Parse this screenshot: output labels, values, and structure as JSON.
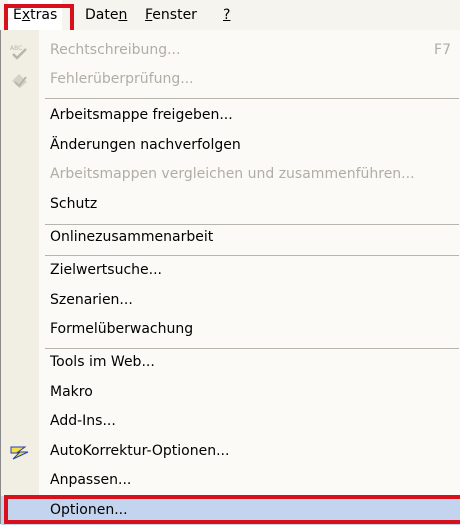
{
  "menubar": {
    "items": [
      {
        "label": "Extras",
        "active": true
      },
      {
        "label": "Daten"
      },
      {
        "label": "Fenster"
      },
      {
        "label": "?"
      }
    ]
  },
  "menu": {
    "items": {
      "rechtschreibung": {
        "label": "Rechtschreibung...",
        "shortcut": "F7",
        "icon": "spellcheck-icon",
        "disabled": true
      },
      "fehlerueberpruefung": {
        "label": "Fehlerüberprüfung...",
        "icon": "error-check-icon",
        "disabled": true
      },
      "arbeitsmappe_freigeben": {
        "label": "Arbeitsmappe freigeben..."
      },
      "aenderungen_nachverfolgen": {
        "label": "Änderungen nachverfolgen"
      },
      "arbeitsmappen_vergleichen": {
        "label": "Arbeitsmappen vergleichen und zusammenführen...",
        "disabled": true
      },
      "schutz": {
        "label": "Schutz"
      },
      "onlinezusammenarbeit": {
        "label": "Onlinezusammenarbeit"
      },
      "zielwertsuche": {
        "label": "Zielwertsuche..."
      },
      "szenarien": {
        "label": "Szenarien..."
      },
      "formelueberwachung": {
        "label": "Formelüberwachung"
      },
      "tools_im_web": {
        "label": "Tools im Web..."
      },
      "makro": {
        "label": "Makro"
      },
      "add_ins": {
        "label": "Add-Ins..."
      },
      "autokorrektur": {
        "label": "AutoKorrektur-Optionen...",
        "icon": "autocorrect-lightning-icon"
      },
      "anpassen": {
        "label": "Anpassen..."
      },
      "optionen": {
        "label": "Optionen...",
        "highlighted": true
      }
    }
  },
  "colors": {
    "highlight": "#c3d4ee",
    "annotation": "#d8101c",
    "disabled_text": "#b0aea4"
  }
}
